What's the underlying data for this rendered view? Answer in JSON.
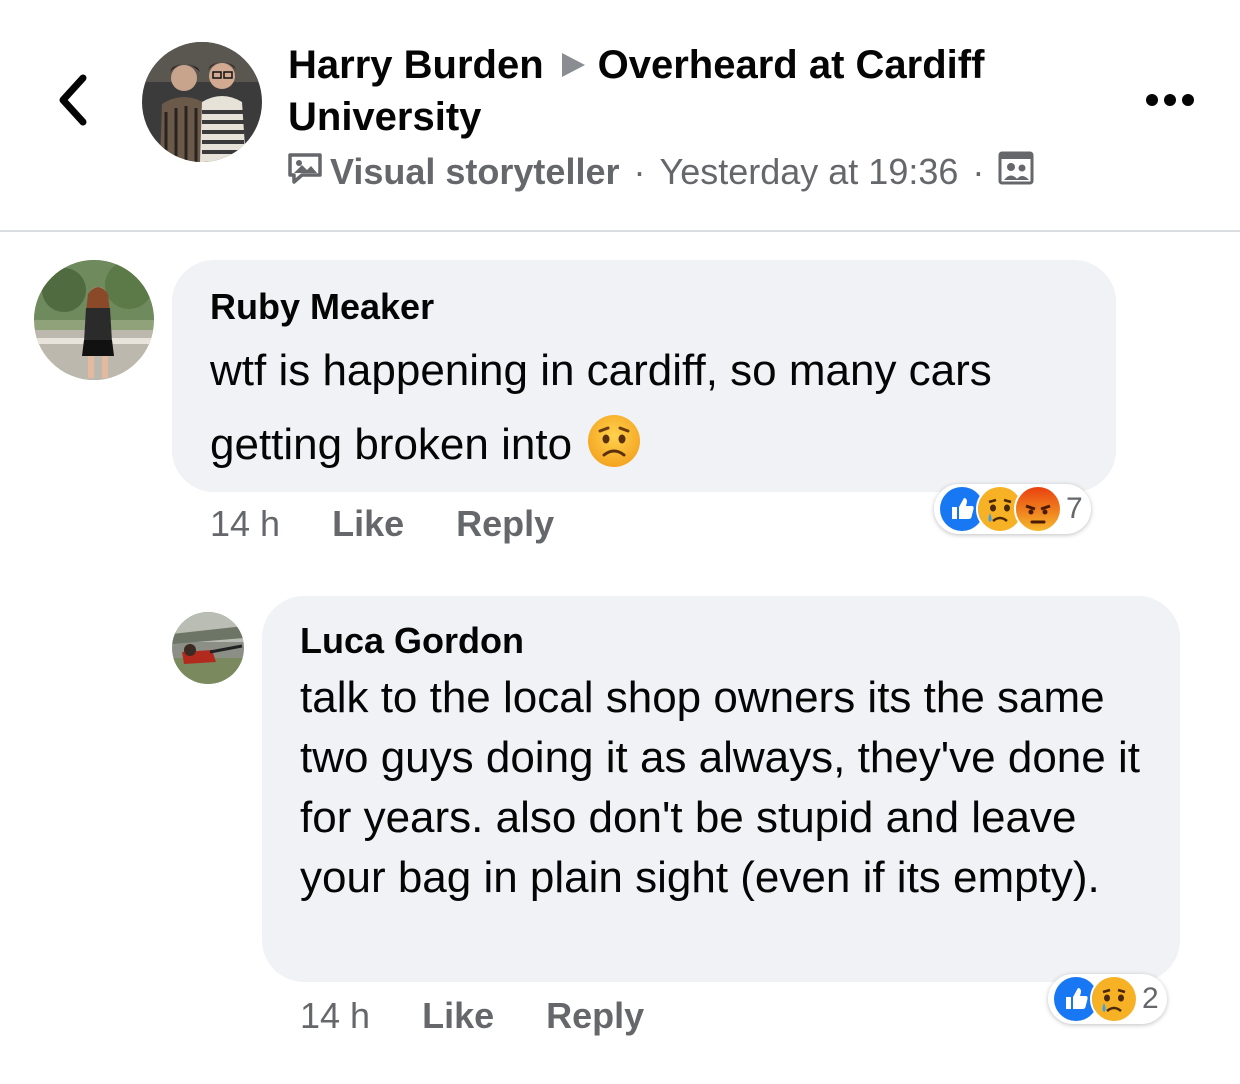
{
  "post": {
    "author": "Harry Burden",
    "group": "Overheard at Cardiff University",
    "badge_label": "Visual storyteller",
    "separator": "·",
    "timestamp": "Yesterday at 19:36",
    "privacy_icon": "group-members-icon"
  },
  "comments": [
    {
      "author": "Ruby Meaker",
      "text": "wtf is happening in cardiff, so many cars getting broken into",
      "emoji": "worried-face",
      "time": "14 h",
      "like_label": "Like",
      "reply_label": "Reply",
      "reactions": [
        "like",
        "sad",
        "angry"
      ],
      "reaction_count": "7"
    },
    {
      "author": "Luca Gordon",
      "text": "talk to the local shop owners its the same two guys doing it as always, they've done it for years. also don't be stupid and leave your bag in plain sight (even if its empty).",
      "time": "14 h",
      "like_label": "Like",
      "reply_label": "Reply",
      "reactions": [
        "like",
        "sad"
      ],
      "reaction_count": "2"
    }
  ],
  "colors": {
    "bubble": "#f0f2f5",
    "secondary_text": "#65676b",
    "like_blue": "#1877f2",
    "sad_yellow": "#f7b125",
    "angry_orange": "#e9710f"
  }
}
